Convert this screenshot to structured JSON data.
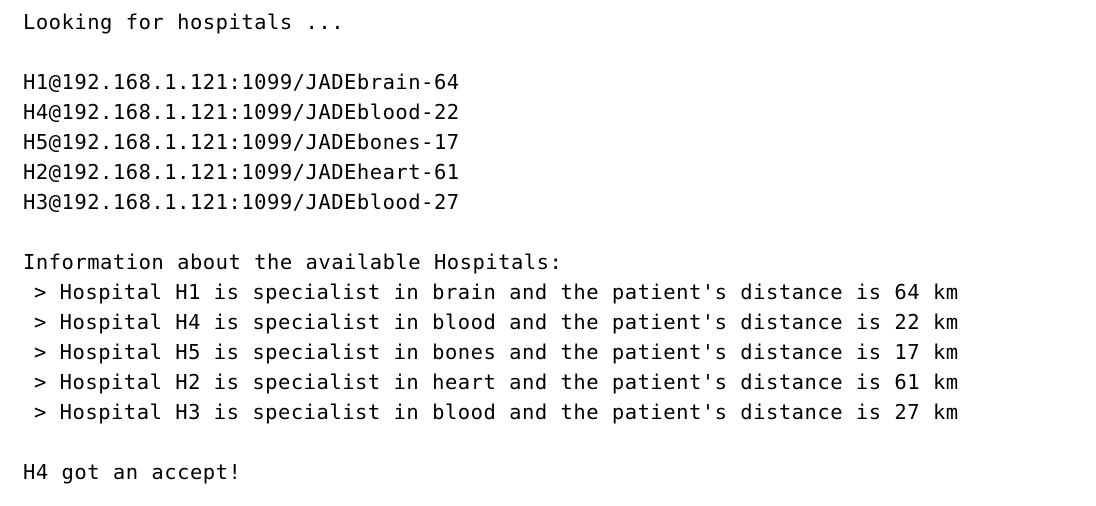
{
  "console": {
    "searching": "Looking for hospitals ...",
    "agents": [
      "H1@192.168.1.121:1099/JADEbrain-64",
      "H4@192.168.1.121:1099/JADEblood-22",
      "H5@192.168.1.121:1099/JADEbones-17",
      "H2@192.168.1.121:1099/JADEheart-61",
      "H3@192.168.1.121:1099/JADEblood-27"
    ],
    "info_header": "Information about the available Hospitals:",
    "hospital_info": [
      "> Hospital H1 is specialist in brain and the patient's distance is 64 km",
      "> Hospital H4 is specialist in blood and the patient's distance is 22 km",
      "> Hospital H5 is specialist in bones and the patient's distance is 17 km",
      "> Hospital H2 is specialist in heart and the patient's distance is 61 km",
      "> Hospital H3 is specialist in blood and the patient's distance is 27 km"
    ],
    "result": "H4 got an accept!"
  }
}
